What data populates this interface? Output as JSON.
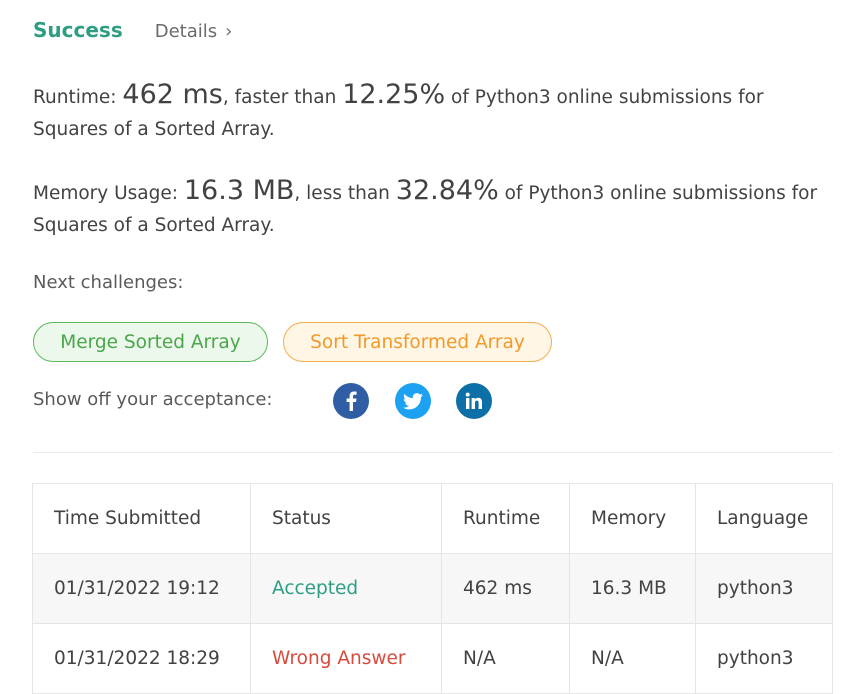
{
  "header": {
    "status": "Success",
    "details_link": "Details",
    "details_chevron": "›"
  },
  "runtime": {
    "label": "Runtime: ",
    "value": "462 ms",
    "comparison": ", faster than ",
    "percent": "12.25%",
    "suffix": " of Python3 online submissions for Squares of a Sorted Array."
  },
  "memory": {
    "label": "Memory Usage: ",
    "value": "16.3 MB",
    "comparison": ", less than ",
    "percent": "32.84%",
    "suffix": " of Python3 online submissions for Squares of a Sorted Array."
  },
  "next_challenges": {
    "label": "Next challenges:",
    "items": [
      {
        "label": "Merge Sorted Array",
        "color": "#5cb85c"
      },
      {
        "label": "Sort Transformed Array",
        "color": "#f0ad4e"
      }
    ]
  },
  "share": {
    "label": "Show off your acceptance:",
    "icons": [
      {
        "name": "facebook-icon",
        "color": "#2f5ea4"
      },
      {
        "name": "twitter-icon",
        "color": "#1da1f2"
      },
      {
        "name": "linkedin-icon",
        "color": "#0c6fa8"
      }
    ]
  },
  "submissions": {
    "columns": [
      "Time Submitted",
      "Status",
      "Runtime",
      "Memory",
      "Language"
    ],
    "rows": [
      {
        "time": "01/31/2022 19:12",
        "status": "Accepted",
        "runtime": "462 ms",
        "memory": "16.3 MB",
        "language": "python3"
      },
      {
        "time": "01/31/2022 18:29",
        "status": "Wrong Answer",
        "runtime": "N/A",
        "memory": "N/A",
        "language": "python3"
      }
    ]
  },
  "colors": {
    "accepted": "#2e9e82",
    "wrong": "#d84a3c"
  }
}
